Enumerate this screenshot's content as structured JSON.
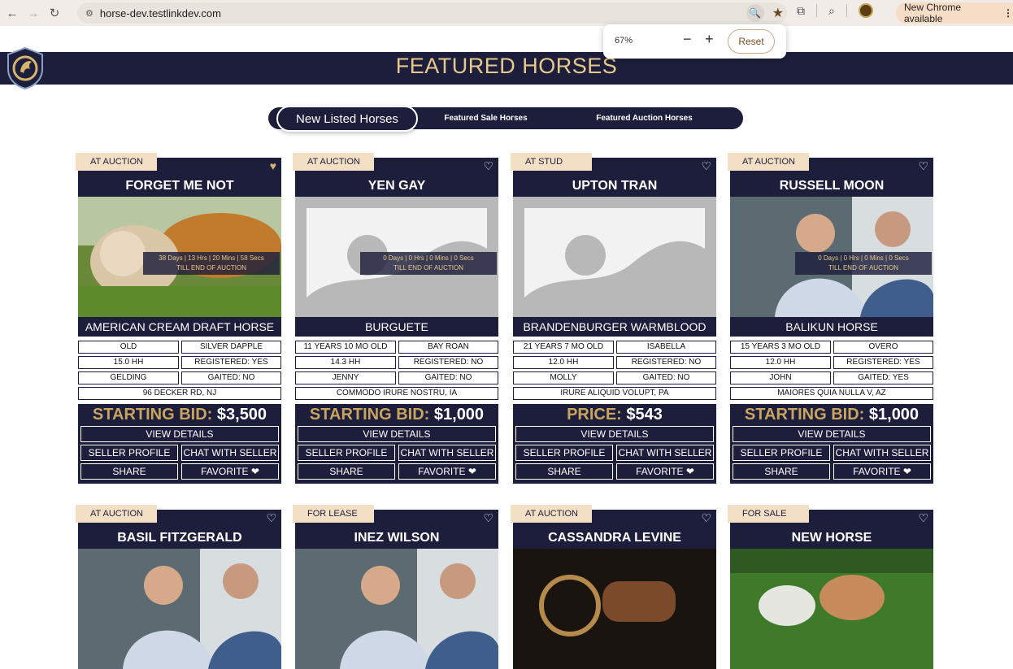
{
  "browser": {
    "url": "horse-dev.testlinkdev.com",
    "new_chrome": "New Chrome available",
    "zoom": {
      "percent": "67%",
      "minus": "−",
      "plus": "+",
      "reset": "Reset"
    }
  },
  "banner": {
    "title": "FEATURED HORSES"
  },
  "tabs": {
    "active": "New Listed Horses",
    "sale": "Featured Sale Horses",
    "auction": "Featured Auction Horses"
  },
  "timer": {
    "till": "TILL END OF AUCTION"
  },
  "buttons": {
    "view": "VIEW DETAILS",
    "seller": "SELLER PROFILE",
    "chat": "CHAT WITH SELLER",
    "share": "SHARE",
    "favorite": "FAVORITE ❤"
  },
  "cards": [
    {
      "badge": "AT AUCTION",
      "name": "FORGET ME NOT",
      "breed": "AMERICAN CREAM DRAFT HORSE",
      "age": "OLD",
      "color": "SILVER DAPPLE",
      "height": "15.0 HH",
      "registered": "REGISTERED: YES",
      "gender": "GELDING",
      "gaited": "GAITED: NO",
      "location": "96 DECKER RD, NJ",
      "price_label": "STARTING BID:",
      "price_value": " $3,500",
      "timer": "38 Days  |  13 Hrs  |  20 Mins  |  58 Secs"
    },
    {
      "badge": "AT AUCTION",
      "name": "YEN GAY",
      "breed": "BURGUETE",
      "age": "11 YEARS 10 MO OLD",
      "color": "BAY ROAN",
      "height": "14.3 HH",
      "registered": "REGISTERED: NO",
      "gender": "JENNY",
      "gaited": "GAITED: NO",
      "location": "COMMODO IRURE NOSTRU, IA",
      "price_label": "STARTING BID:",
      "price_value": " $1,000",
      "timer": "0 Days  |  0 Hrs  |  0 Mins  |  0 Secs"
    },
    {
      "badge": "AT STUD",
      "name": "UPTON TRAN",
      "breed": "BRANDENBURGER WARMBLOOD",
      "age": "21 YEARS 7 MO OLD",
      "color": "ISABELLA",
      "height": "12.0 HH",
      "registered": "REGISTERED: NO",
      "gender": "MOLLY",
      "gaited": "GAITED: NO",
      "location": "IRURE ALIQUID VOLUPT, PA",
      "price_label": "PRICE:",
      "price_value": " $543"
    },
    {
      "badge": "AT AUCTION",
      "name": "RUSSELL MOON",
      "breed": "BALIKUN HORSE",
      "age": "15 YEARS 3 MO OLD",
      "color": "OVERO",
      "height": "12.0 HH",
      "registered": "REGISTERED: YES",
      "gender": "JOHN",
      "gaited": "GAITED: YES",
      "location": "MAIORES QUIA NULLA V, AZ",
      "price_label": "STARTING BID:",
      "price_value": " $1,000",
      "timer": "0 Days  |  0 Hrs  |  0 Mins  |  0 Secs"
    },
    {
      "badge": "AT AUCTION",
      "name": "BASIL FITZGERALD"
    },
    {
      "badge": "FOR LEASE",
      "name": "INEZ WILSON"
    },
    {
      "badge": "AT AUCTION",
      "name": "CASSANDRA LEVINE"
    },
    {
      "badge": "FOR SALE",
      "name": "NEW HORSE"
    }
  ]
}
